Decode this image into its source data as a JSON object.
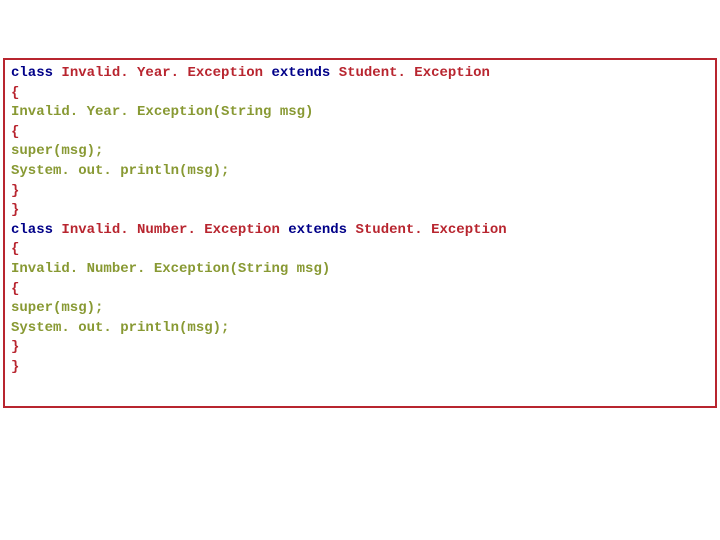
{
  "code": {
    "l1_kw": "class ",
    "l1_name": "Invalid. Year. Exception ",
    "l1_ext": "extends ",
    "l1_parent": "Student. Exception",
    "l2": "{",
    "l3_ctor": "Invalid. Year. Exception",
    "l3_args": "(String msg)",
    "l4": "{",
    "l5": "super(msg);",
    "l6": "System. out. println(msg);",
    "l7": "}",
    "l8": "}",
    "l9_kw": "class ",
    "l9_name": "Invalid. Number. Exception ",
    "l9_ext": "extends ",
    "l9_parent": "Student. Exception",
    "l10": "{",
    "l11_ctor": "Invalid. Number. Exception",
    "l11_args": "(String msg)",
    "l12": "{",
    "l13": "super(msg);",
    "l14": "System. out. println(msg);",
    "l15": "}",
    "l16": "}"
  }
}
